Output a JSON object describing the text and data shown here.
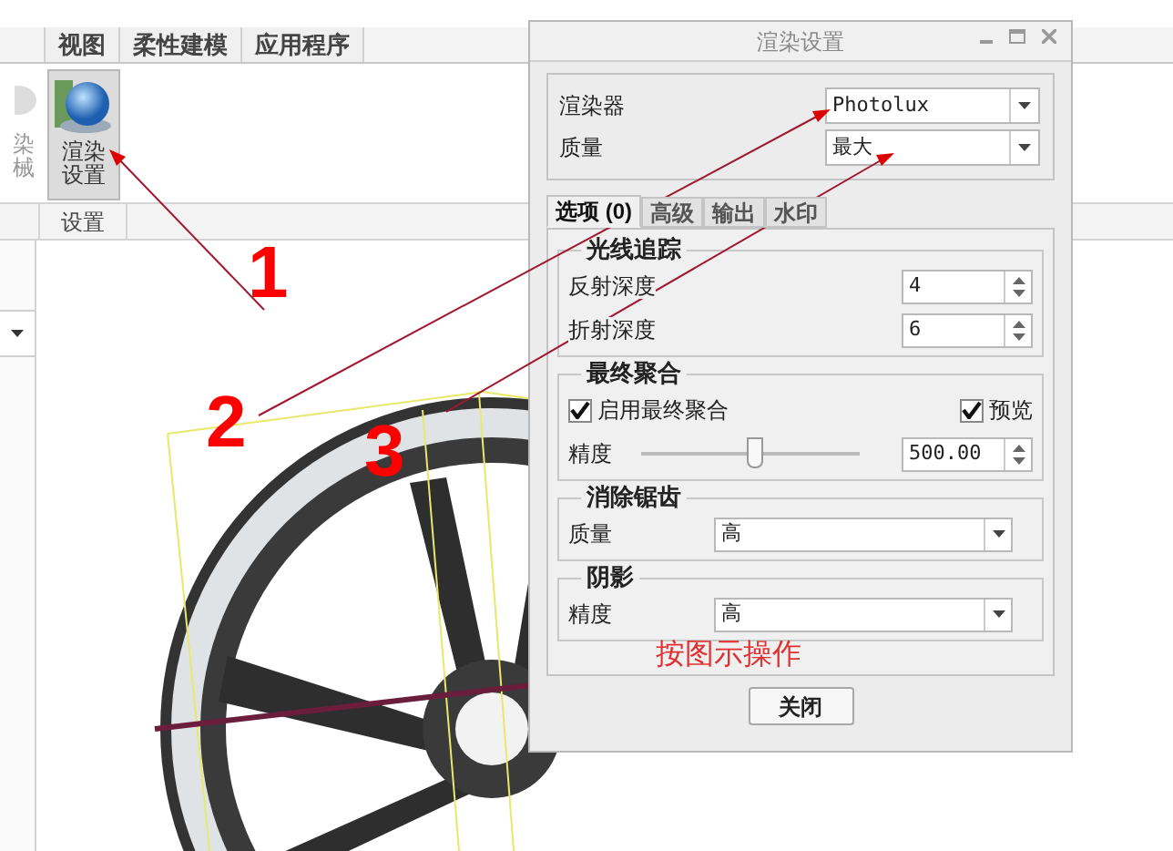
{
  "ribbon": {
    "tabs": [
      {
        "label": "视图",
        "selected": false
      },
      {
        "label": "柔性建模",
        "selected": false
      },
      {
        "label": "应用程序",
        "selected": false
      }
    ],
    "buttons": [
      {
        "kind": "cut",
        "lines": [
          "染",
          "械"
        ]
      },
      {
        "kind": "render",
        "lines": [
          "渲染",
          "设置"
        ],
        "selected": true
      }
    ],
    "group_label": "设置"
  },
  "dialog": {
    "title": "渲染设置",
    "fields": [
      {
        "label": "渲染器",
        "value": "Photolux"
      },
      {
        "label": "质量",
        "value": "最大"
      }
    ],
    "tabs": [
      {
        "label": "选项 (0)",
        "selected": true
      },
      {
        "label": "高级",
        "selected": false
      },
      {
        "label": "输出",
        "selected": false
      },
      {
        "label": "水印",
        "selected": false
      }
    ],
    "sections": [
      {
        "title": "光线追踪",
        "rows": [
          {
            "kind": "spin",
            "label": "反射深度",
            "value": "4"
          },
          {
            "kind": "spin",
            "label": "折射深度",
            "value": "6"
          }
        ]
      },
      {
        "title": "最终聚合",
        "rows": [
          {
            "kind": "checks",
            "items": [
              {
                "label": "启用最终聚合",
                "checked": true
              },
              {
                "label": "预览",
                "checked": true
              }
            ]
          },
          {
            "kind": "slider",
            "label": "精度",
            "level": 0.5,
            "value": "500.00"
          }
        ]
      },
      {
        "title": "消除锯齿",
        "rows": [
          {
            "kind": "select",
            "label": "质量",
            "value": "高"
          }
        ]
      },
      {
        "title": "阴影",
        "rows": [
          {
            "kind": "select",
            "label": "精度",
            "value": "高"
          }
        ]
      }
    ],
    "close_button": "关闭"
  },
  "annotations": {
    "numbers": [
      "1",
      "2",
      "3"
    ],
    "note": "按图示操作"
  }
}
